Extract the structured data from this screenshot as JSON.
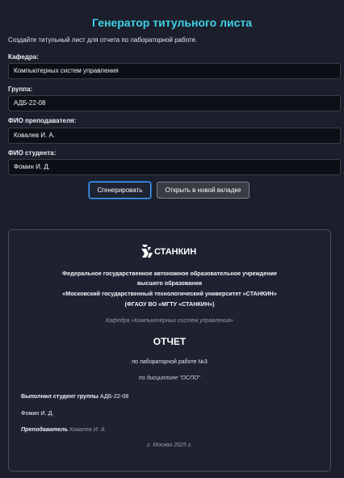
{
  "header": {
    "title": "Генератор титульного листа",
    "subtitle": "Создайте титульный лист для отчета по лабораторной работе."
  },
  "form": {
    "department_label": "Кафедра:",
    "department_value": "Компьютерных систем управления",
    "group_label": "Группа:",
    "group_value": "АДБ-22-08",
    "teacher_label": "ФИО преподавателя:",
    "teacher_value": "Ковалев И. А.",
    "student_label": "ФИО студента:",
    "student_value": "Фомин И. Д."
  },
  "buttons": {
    "generate_label": "Сгенерировать",
    "open_tab_label": "Открыть в новой вкладке"
  },
  "preview": {
    "logo_text": "СТАНКИН",
    "org_line1": "Федеральное государственное автономное образовательное учреждение",
    "org_line2": "высшего образования",
    "org_line3": "«Московский государственный технологический университет «СТАНКИН»",
    "org_line4": "(ФГАОУ ВО «МГТУ «СТАНКИН»)",
    "department": "Кафедра «Компьютерных систем управления»",
    "doc_title": "ОТЧЕТ",
    "lab_line": "по лабораторной работе №3",
    "discipline_line": "по дисциплине \"ОСПО\"",
    "performed_label": "Выполнил студент группы",
    "performed_group": "АДБ-22-08",
    "student_name": "Фомин И. Д.",
    "teacher_label": "Преподаватель",
    "teacher_name": "Ковалев И. А.",
    "city_year": "г. Москва 2025 г."
  },
  "colors": {
    "background": "#1c1f2b",
    "title_accent": "#3fd1e6",
    "primary_border": "#4aa3ff"
  }
}
